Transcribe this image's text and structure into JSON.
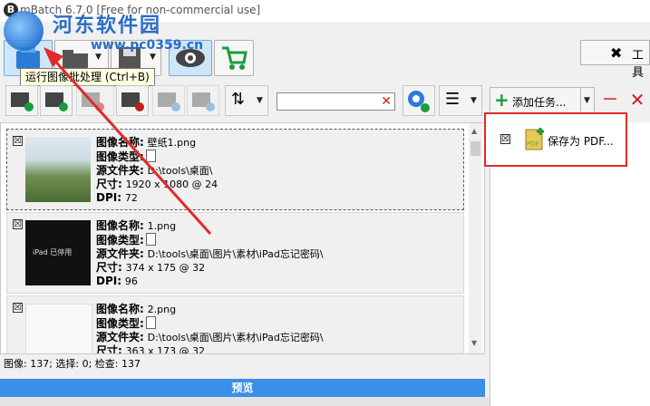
{
  "window": {
    "title": "mBatch 6.7.0 [Free for non-commercial use]"
  },
  "watermark": {
    "site_name": "河东软件园",
    "url": "www.pc0359.cn"
  },
  "toolbar": {
    "tooltip": "运行图像批处理 (Ctrl+B)",
    "tools_label": "工具"
  },
  "search": {
    "value": "",
    "placeholder": ""
  },
  "images": [
    {
      "name_label": "图像名称:",
      "name": "壁纸1.png",
      "type_label": "图像类型:",
      "folder_label": "源文件夹:",
      "folder": "D:\\tools\\桌面\\",
      "size_label": "尺寸:",
      "size": "1920 x 1080 @ 24",
      "dpi_label": "DPI:",
      "dpi": "72",
      "checked": "☒"
    },
    {
      "name_label": "图像名称:",
      "name": "1.png",
      "type_label": "图像类型:",
      "folder_label": "源文件夹:",
      "folder": "D:\\tools\\桌面\\图片\\素材\\iPad忘记密码\\",
      "size_label": "尺寸:",
      "size": "374 x 175 @ 32",
      "dpi_label": "DPI:",
      "dpi": "96",
      "checked": "☒",
      "thumb_text": "iPad 已停用"
    },
    {
      "name_label": "图像名称:",
      "name": "2.png",
      "type_label": "图像类型:",
      "folder_label": "源文件夹:",
      "folder": "D:\\tools\\桌面\\图片\\素材\\iPad忘记密码\\",
      "size_label": "尺寸:",
      "size": "363 x 173 @ 32",
      "checked": "☒"
    }
  ],
  "status": {
    "text": "图像: 137; 选择: 0; 检查: 137"
  },
  "preview": {
    "label": "预览"
  },
  "tasks": {
    "add_label": "添加任务...",
    "items": [
      {
        "label": "保存为 PDF...",
        "checked": "☒"
      }
    ]
  },
  "colors": {
    "accent": "#3b8fe6",
    "highlight": "#e12a2a",
    "arrow": "#e12a2a"
  }
}
